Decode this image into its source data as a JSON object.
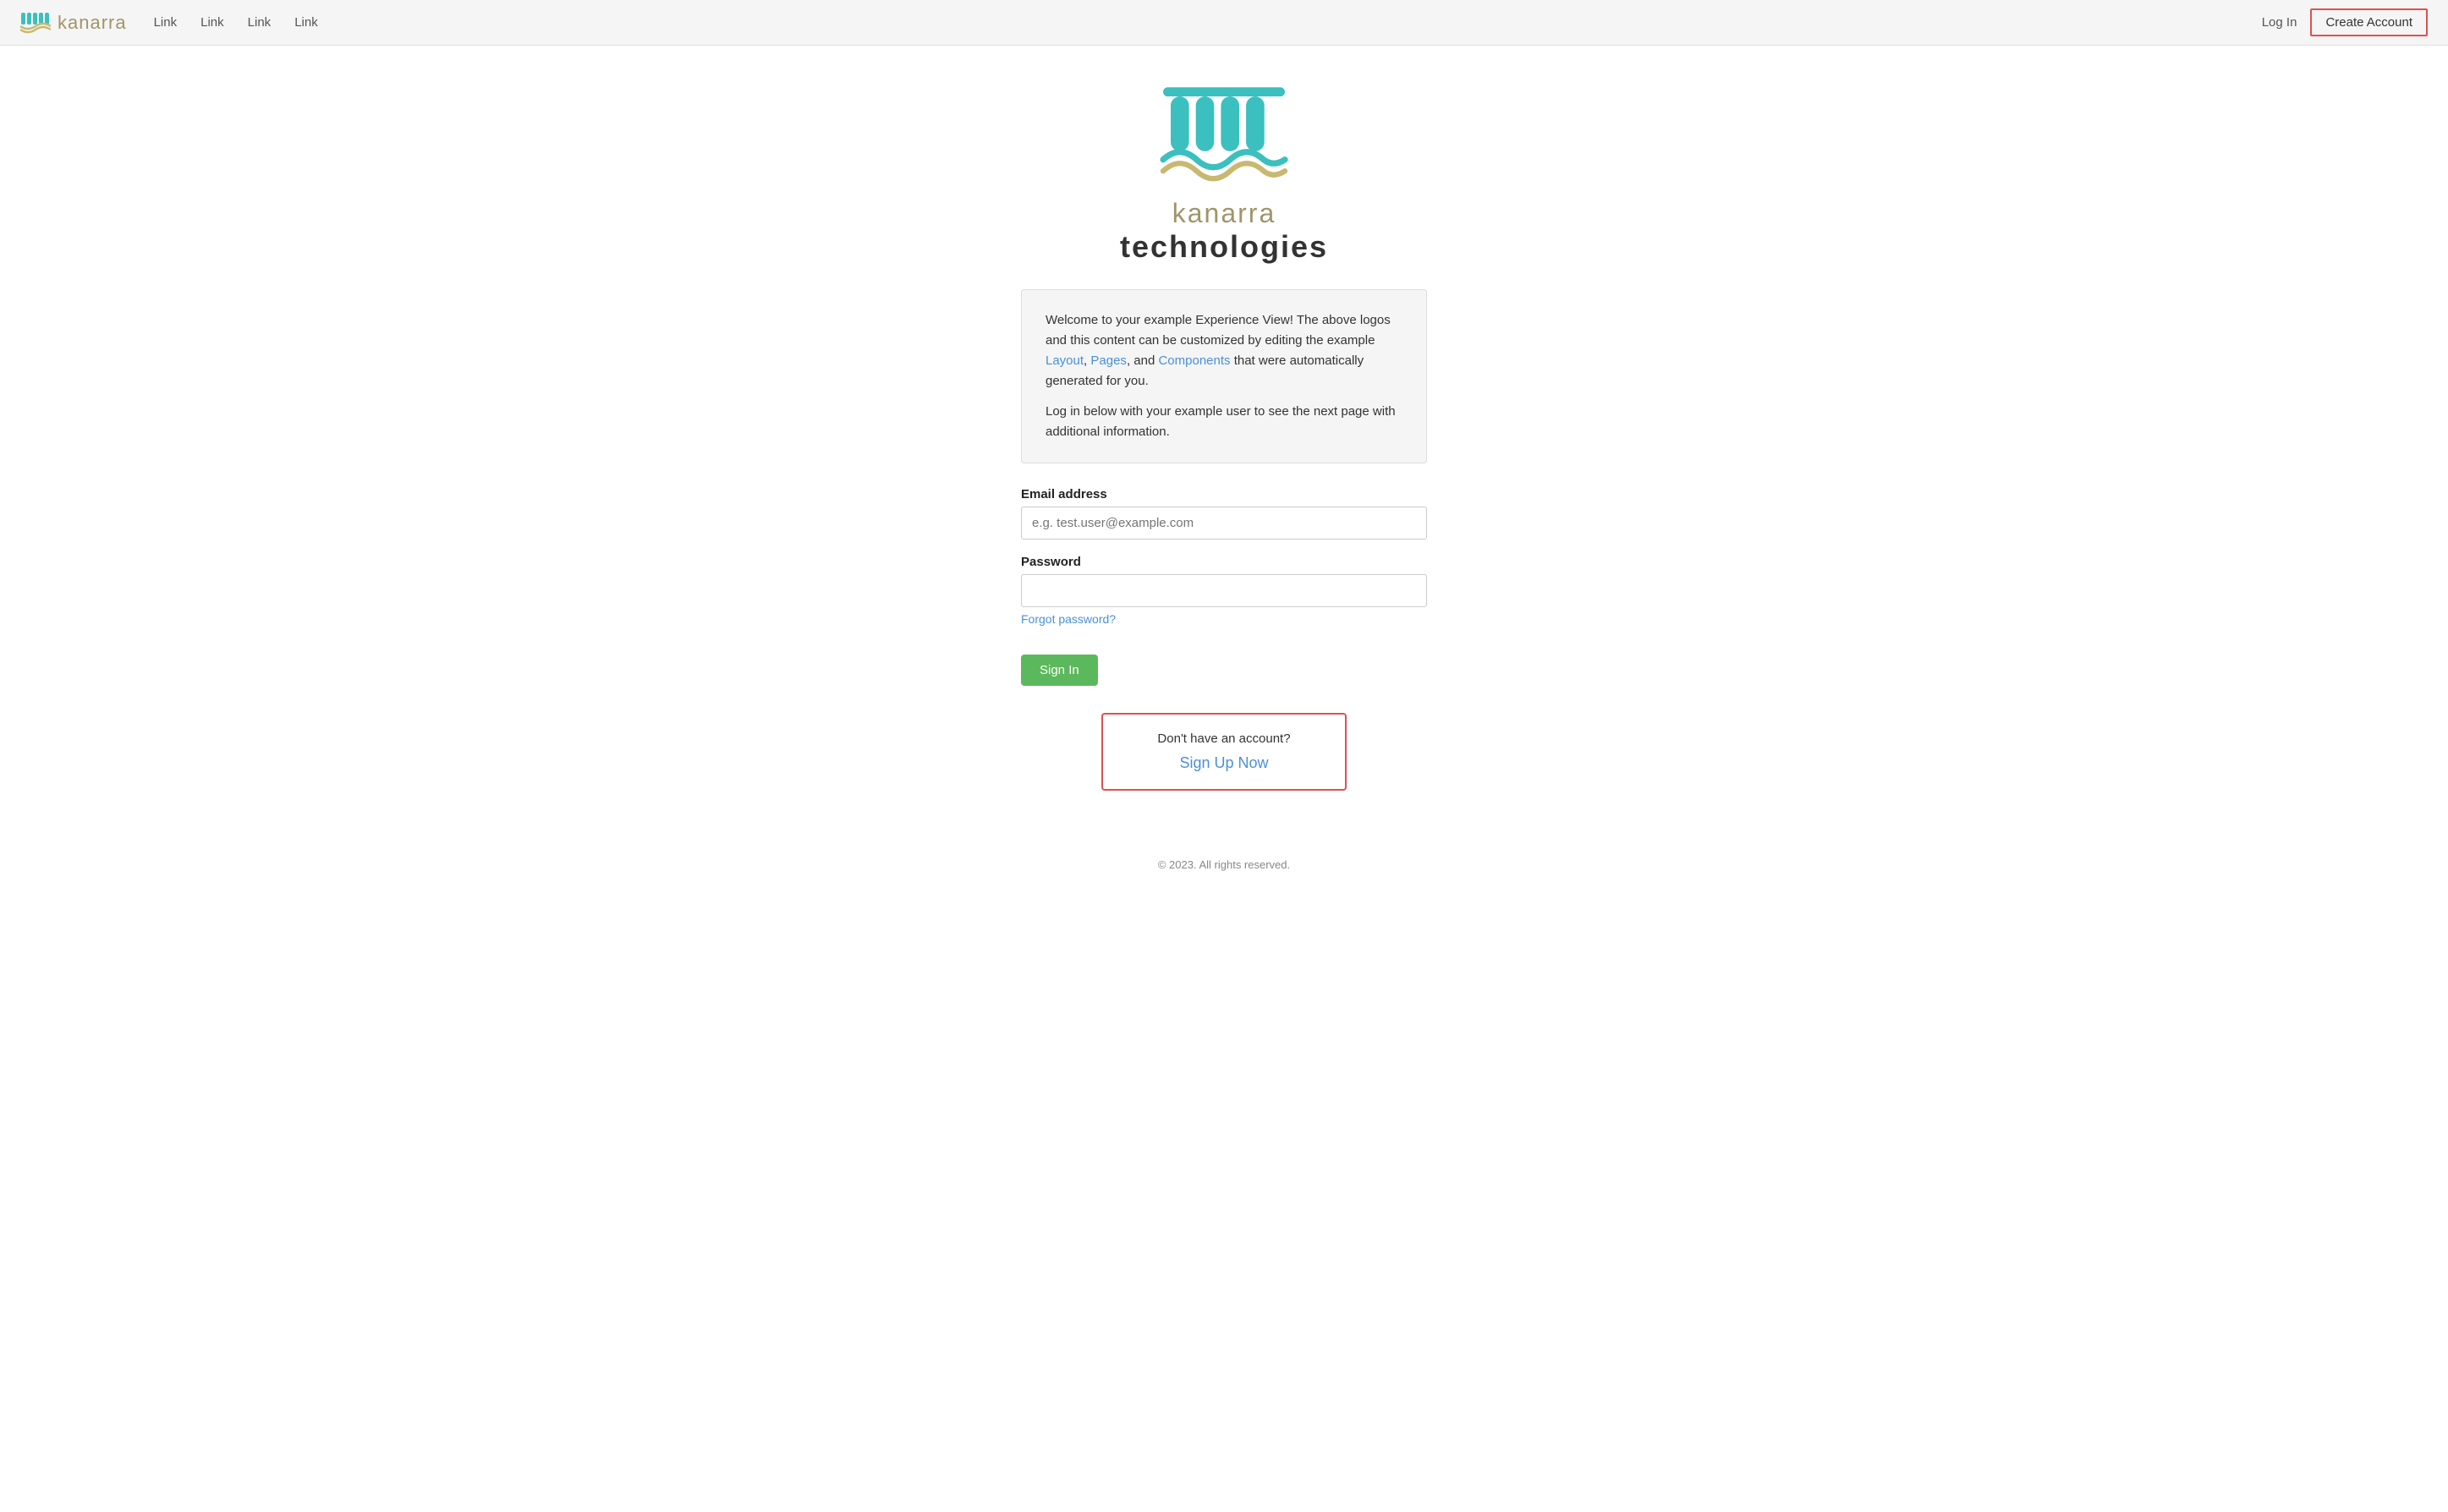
{
  "navbar": {
    "logo_text": "kanarra",
    "links": [
      "Link",
      "Link",
      "Link",
      "Link"
    ],
    "login_label": "Log In",
    "create_account_label": "Create Account"
  },
  "brand": {
    "name_part1": "kanarra",
    "name_part2": "technologies"
  },
  "welcome": {
    "paragraph1_prefix": "Welcome to your example Experience View! The above logos and this content can be customized by editing the example ",
    "layout_link": "Layout",
    "paragraph1_middle": ", ",
    "pages_link": "Pages",
    "paragraph1_and": ", and ",
    "components_link": "Components",
    "paragraph1_suffix": " that were automatically generated for you.",
    "paragraph2": "Log in below with your example user to see the next page with additional information."
  },
  "form": {
    "email_label": "Email address",
    "email_placeholder": "e.g. test.user@example.com",
    "password_label": "Password",
    "password_placeholder": "",
    "forgot_password": "Forgot password?",
    "sign_in_label": "Sign In"
  },
  "signup": {
    "prompt": "Don't have an account?",
    "link_label": "Sign Up Now"
  },
  "footer": {
    "copyright": "© 2023. All rights reserved."
  }
}
